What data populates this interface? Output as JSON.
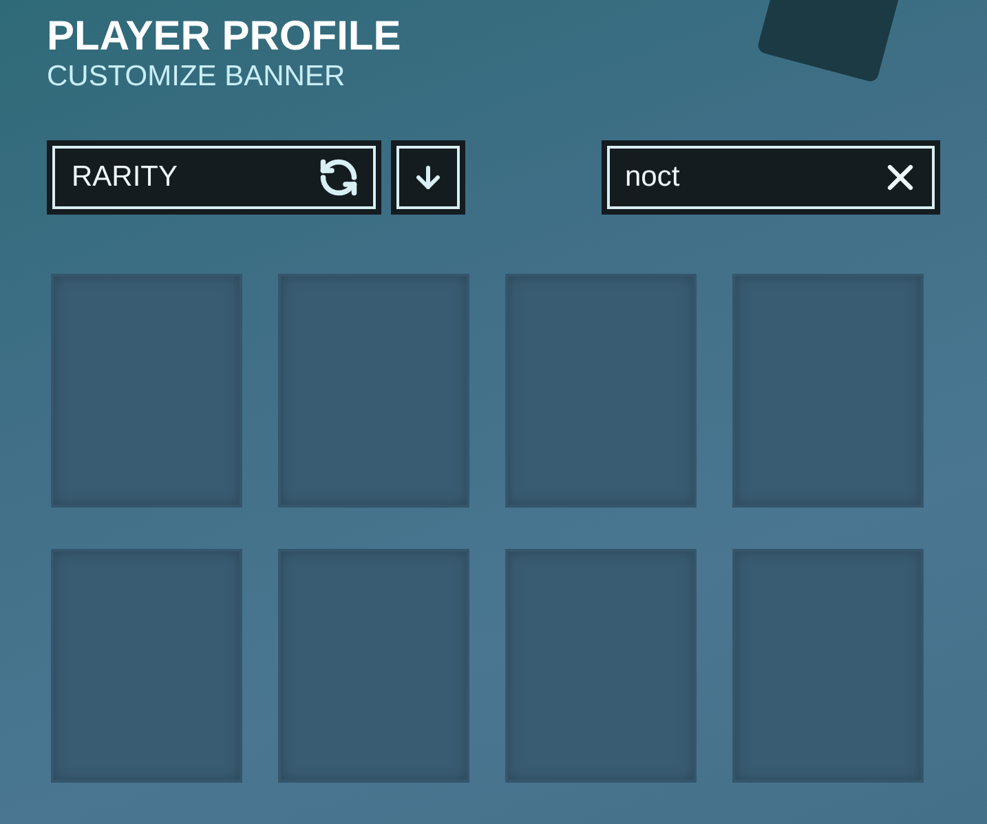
{
  "header": {
    "title": "PLAYER PROFILE",
    "subtitle": "CUSTOMIZE BANNER"
  },
  "sort": {
    "label": "RARITY"
  },
  "search": {
    "value": "noct"
  },
  "slots": [
    {
      "kind": "empty"
    },
    {
      "kind": "empty"
    },
    {
      "kind": "empty"
    },
    {
      "kind": "empty"
    },
    {
      "kind": "empty"
    },
    {
      "kind": "empty"
    },
    {
      "kind": "empty"
    },
    {
      "kind": "empty"
    }
  ]
}
